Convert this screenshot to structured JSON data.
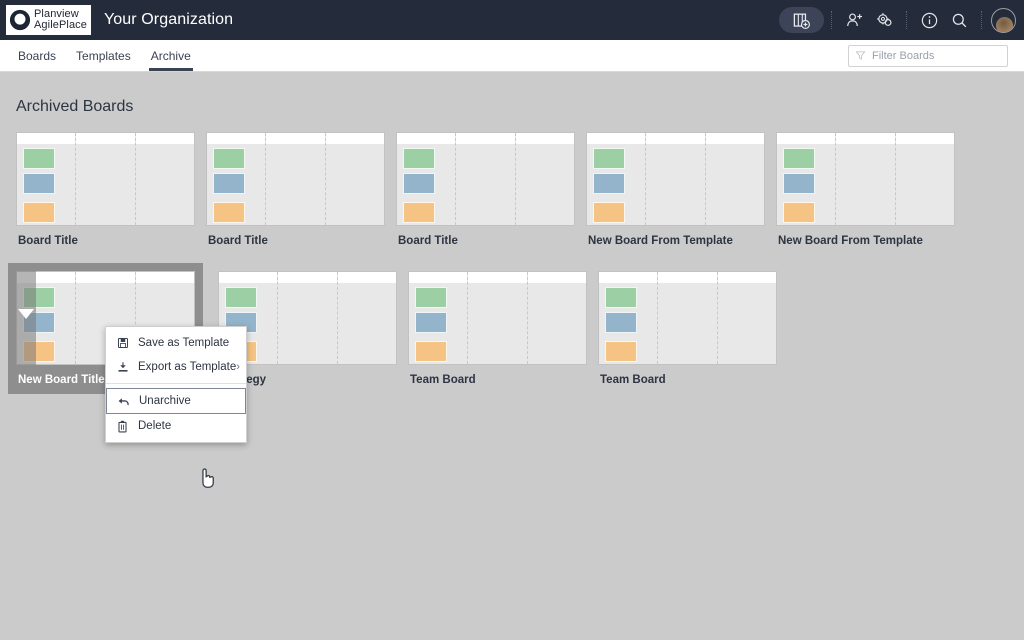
{
  "header": {
    "logo_line1": "Planview",
    "logo_line2": "AgilePlace",
    "logo_icon": "planview-circle-logo",
    "org_title": "Your Organization",
    "actions": [
      {
        "name": "add-board-button",
        "icon": "board-plus-icon"
      },
      {
        "name": "invite-user-button",
        "icon": "user-plus-icon"
      },
      {
        "name": "settings-button",
        "icon": "gear-icon"
      },
      {
        "name": "info-button",
        "icon": "info-circle-icon"
      },
      {
        "name": "search-button",
        "icon": "search-icon"
      },
      {
        "name": "user-avatar",
        "icon": "avatar-icon"
      }
    ]
  },
  "nav": {
    "tabs": [
      {
        "label": "Boards",
        "active": false
      },
      {
        "label": "Templates",
        "active": false
      },
      {
        "label": "Archive",
        "active": true
      }
    ],
    "filter": {
      "placeholder": "Filter Boards",
      "value": "",
      "icon": "filter-funnel-icon"
    }
  },
  "main": {
    "page_title": "Archived Boards",
    "rows": [
      {
        "cards": [
          {
            "title": "Board Title",
            "selected": false
          },
          {
            "title": "Board Title",
            "selected": false
          },
          {
            "title": "Board Title",
            "selected": false
          },
          {
            "title": "New Board From Template",
            "selected": false
          },
          {
            "title": "New Board From Template",
            "selected": false
          }
        ]
      },
      {
        "cards": [
          {
            "title": "New Board Title",
            "selected": true
          },
          {
            "title": "Strategy",
            "selected": false
          },
          {
            "title": "Team Board",
            "selected": false
          },
          {
            "title": "Team Board",
            "selected": false
          }
        ]
      }
    ],
    "thumbnail": {
      "lane_count": 3,
      "mini_cards": [
        {
          "color_name": "green",
          "color": "#9ccfa3"
        },
        {
          "color_name": "blue",
          "color": "#93b4cb"
        },
        {
          "color_name": "orange",
          "color": "#f5c383"
        }
      ]
    }
  },
  "context_menu": {
    "items": [
      {
        "label": "Save as Template",
        "icon": "floppy-save-icon",
        "submenu": false,
        "hovered": false
      },
      {
        "label": "Export as Template",
        "icon": "download-tray-icon",
        "submenu": true,
        "chevron": "›",
        "hovered": false
      },
      {
        "label": "Unarchive",
        "icon": "undo-arrow-icon",
        "submenu": false,
        "hovered": true
      },
      {
        "label": "Delete",
        "icon": "trash-icon",
        "submenu": false,
        "hovered": false
      }
    ]
  },
  "colors": {
    "header_bg": "#242b3b",
    "page_bg": "#cbcbcb",
    "accent_text": "#2d3442",
    "selected_card_bg": "#8e8e8e",
    "card_green": "#9ccfa3",
    "card_blue": "#93b4cb",
    "card_orange": "#f5c383"
  }
}
